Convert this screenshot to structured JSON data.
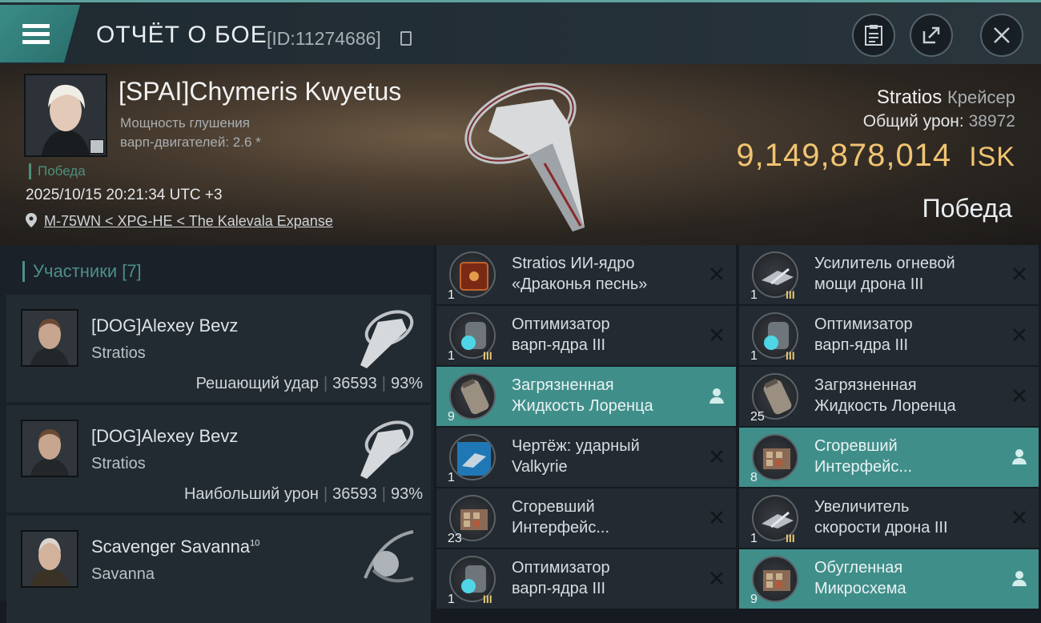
{
  "header": {
    "title": "ОТЧЁТ О БОЕ",
    "report_id": "[ID:11274686]"
  },
  "victim": {
    "name": "[SPAI]Chymeris Kwyetus",
    "scram_label_line1": "Мощность глушения",
    "scram_label_line2": "варп-двигателей: 2.6 *",
    "status": "Победа",
    "datetime": "2025/10/15 20:21:34 UTC +3",
    "location": "M-75WN < XPG-HE < The Kalevala Expanse",
    "ship": "Stratios",
    "ship_class": "Крейсер",
    "total_damage_label": "Общий урон:",
    "total_damage": "38972",
    "isk_value": "9,149,878,014",
    "isk_unit": "ISK",
    "result": "Победа"
  },
  "participants": {
    "label": "Участники [7]",
    "list": [
      {
        "name": "[DOG]Alexey Bevz",
        "ship": "Stratios",
        "role": "Решающий удар",
        "damage": "36593",
        "percent": "93%"
      },
      {
        "name": "[DOG]Alexey Bevz",
        "ship": "Stratios",
        "role": "Наибольший урон",
        "damage": "36593",
        "percent": "93%"
      },
      {
        "name": "Scavenger Savanna",
        "name_sup": "10",
        "ship": "Savanna"
      }
    ]
  },
  "items": [
    {
      "line1": "Stratios ИИ-ядро",
      "line2": "«Драконья песнь»",
      "qty": "1",
      "meta": "",
      "status": "destroyed",
      "icon": "ai-core-icon"
    },
    {
      "line1": "Усилитель огневой",
      "line2": "мощи дрона III",
      "qty": "1",
      "meta": "III",
      "status": "destroyed",
      "icon": "drone-module-icon"
    },
    {
      "line1": "Оптимизатор",
      "line2": "варп-ядра III",
      "qty": "1",
      "meta": "III",
      "status": "destroyed",
      "icon": "warp-optimizer-icon"
    },
    {
      "line1": "Оптимизатор",
      "line2": "варп-ядра III",
      "qty": "1",
      "meta": "III",
      "status": "destroyed",
      "icon": "warp-optimizer-icon"
    },
    {
      "line1": "Загрязненная",
      "line2": "Жидкость Лоренца",
      "qty": "9",
      "meta": "",
      "status": "dropped",
      "icon": "canister-icon"
    },
    {
      "line1": "Загрязненная",
      "line2": "Жидкость Лоренца",
      "qty": "25",
      "meta": "",
      "status": "destroyed",
      "icon": "canister-icon"
    },
    {
      "line1": "Чертёж: ударный",
      "line2": "Valkyrie",
      "qty": "1",
      "meta": "",
      "status": "destroyed",
      "icon": "blueprint-icon"
    },
    {
      "line1": "Сгоревший",
      "line2": "Интерфейс...",
      "qty": "8",
      "meta": "",
      "status": "dropped",
      "icon": "circuit-icon"
    },
    {
      "line1": "Сгоревший",
      "line2": "Интерфейс...",
      "qty": "23",
      "meta": "",
      "status": "destroyed",
      "icon": "circuit-icon"
    },
    {
      "line1": "Увеличитель",
      "line2": "скорости дрона III",
      "qty": "1",
      "meta": "III",
      "status": "destroyed",
      "icon": "drone-module-icon"
    },
    {
      "line1": "Оптимизатор",
      "line2": "варп-ядра III",
      "qty": "1",
      "meta": "III",
      "status": "destroyed",
      "icon": "warp-optimizer-icon"
    },
    {
      "line1": "Обугленная",
      "line2": "Микросхема",
      "qty": "9",
      "meta": "",
      "status": "dropped",
      "icon": "circuit-icon"
    }
  ],
  "colors": {
    "accent_teal": "#3f8e8a",
    "isk_gold": "#f1c471",
    "victory_green": "#4d8f7b"
  }
}
